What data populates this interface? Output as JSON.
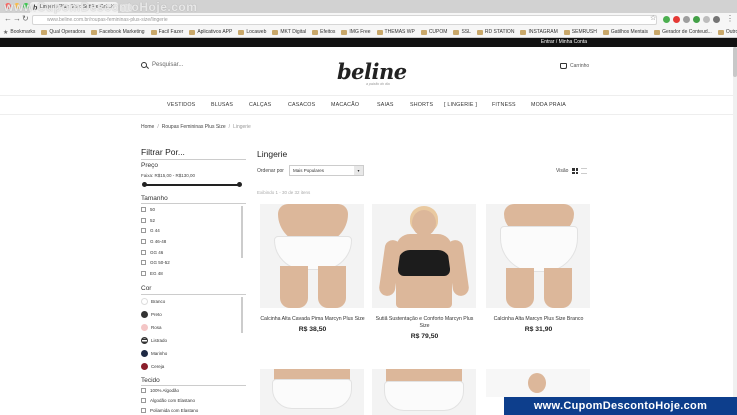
{
  "browser": {
    "tab_title": "Lingerie Plus Size: Sutiã e Cal...",
    "url": "www.beline.com.br/roupas-femininas-plus-size/lingerie",
    "bookmarks": [
      "Bookmarks",
      "Qual Operadora",
      "Facebook Marketing",
      "Facil Fazer",
      "Aplicativos APP",
      "Locaweb",
      "MKT Digital",
      "Efeitos",
      "IMG Free",
      "THEMAS WP",
      "CUPOM",
      "SSL",
      "RD STATION",
      "INSTAGRAM",
      "SEMRUSH",
      "Gatilhos Mentais",
      "Gerador de Conteud...",
      "Outros favoritos"
    ]
  },
  "watermark": {
    "top": "www.CupomDescontoHoje.com",
    "bottom": "www.CupomDescontoHoje.com"
  },
  "topbar": {
    "account": "Entrar / Minha Conta"
  },
  "header": {
    "search_placeholder": "Pesquisar...",
    "logo": "beline",
    "logo_sub": "a paixão do dia",
    "cart": "Carrinho"
  },
  "menu": [
    "VESTIDOS",
    "BLUSAS",
    "CALÇAS",
    "CASACOS",
    "MACACÃO",
    "SAIAS",
    "SHORTS",
    "[ LINGERIE ]",
    "FITNESS",
    "MODA PRAIA"
  ],
  "breadcrumb": {
    "home": "Home",
    "section": "Roupas Femininas Plus Size",
    "current": "Lingerie"
  },
  "filters": {
    "title": "Filtrar Por...",
    "price": {
      "label": "Preço",
      "range": "Faixa: R$15,00 - R$130,00"
    },
    "size": {
      "label": "Tamanho",
      "options": [
        "50",
        "52",
        "G 44",
        "G 46-48",
        "GG 46",
        "GG 50-52",
        "EG 48"
      ]
    },
    "color": {
      "label": "Cor",
      "options": [
        {
          "name": "Branco",
          "color": "#ffffff"
        },
        {
          "name": "Preto",
          "color": "#333333"
        },
        {
          "name": "Rosa",
          "color": "#f4c6c6"
        },
        {
          "name": "Listrado",
          "color": "#333333"
        },
        {
          "name": "Marinho",
          "color": "#1f2a44"
        },
        {
          "name": "Cereja",
          "color": "#8b1e2b"
        }
      ]
    },
    "fabric": {
      "label": "Tecido",
      "options": [
        "100% Algodão",
        "Algodão com Elastano",
        "Poliamida com Elastano"
      ]
    }
  },
  "main": {
    "title": "Lingerie",
    "sort_label": "Ordenar por",
    "sort_value": "Mais Populares",
    "view_label": "Visão",
    "count": "Exibindo 1 - 30 de 32 itens"
  },
  "products": [
    {
      "name": "Calcinha Alta Cavada Pima Marcyn Plus Size",
      "price": "R$ 38,50"
    },
    {
      "name": "Sutiã Sustentação e Conforto Marcyn Plus Size",
      "price": "R$ 79,50"
    },
    {
      "name": "Calcinha Alta Marcyn Plus Size Branco",
      "price": "R$ 31,90"
    }
  ]
}
